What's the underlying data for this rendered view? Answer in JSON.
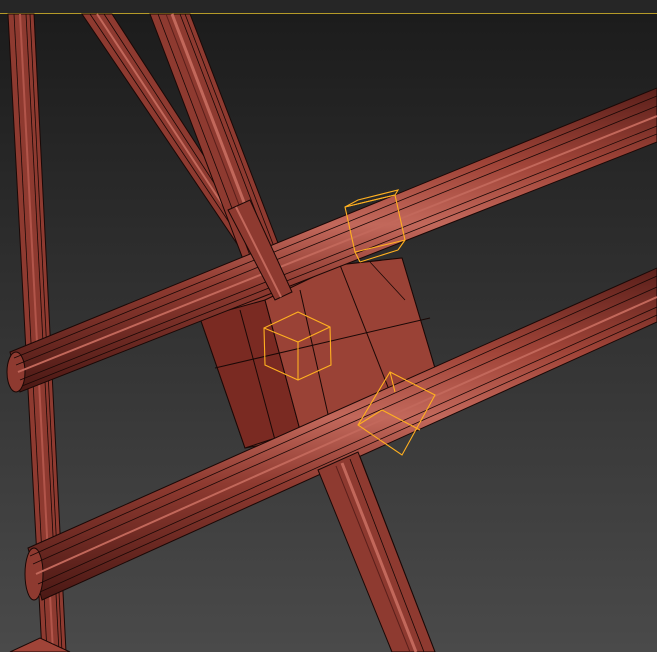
{
  "viewport": {
    "label": "",
    "shading": "edged-faces",
    "colors": {
      "background_top": "#1c1c1c",
      "background_bottom": "#4a4a4a",
      "mesh_fill": "#8e3a30",
      "mesh_fill_light": "#b2554a",
      "mesh_fill_dark": "#5a1f1a",
      "mesh_edge": "#1a0806",
      "selection_gizmo": "#ffb020",
      "frame_highlight": "#b59a28"
    }
  },
  "scene": {
    "objects": [
      {
        "name": "cylinder-rod",
        "kind": "rod"
      },
      {
        "name": "box-joint",
        "kind": "box"
      },
      {
        "name": "selection-bbox",
        "kind": "gizmo"
      }
    ]
  }
}
